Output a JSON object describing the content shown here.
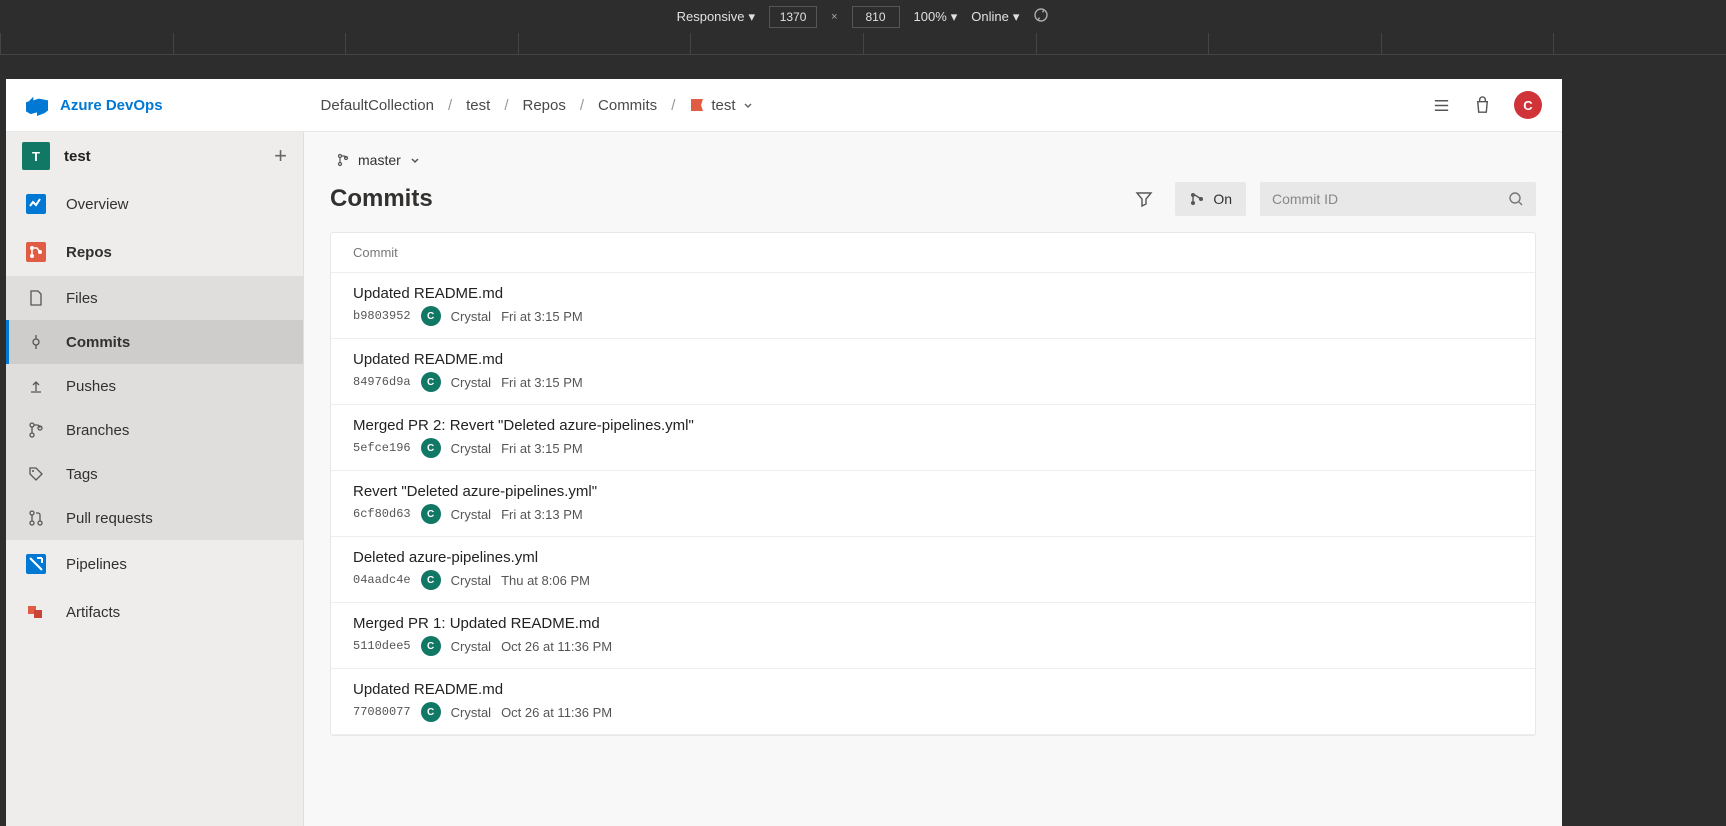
{
  "devtools": {
    "mode": "Responsive",
    "width": "1370",
    "height": "810",
    "zoom": "100%",
    "throttle": "Online"
  },
  "brand": "Azure DevOps",
  "breadcrumb": {
    "collection": "DefaultCollection",
    "project": "test",
    "section": "Repos",
    "subsection": "Commits",
    "repo": "test"
  },
  "avatar_letter": "C",
  "sidebar": {
    "project_letter": "T",
    "project_name": "test",
    "overview": "Overview",
    "repos": "Repos",
    "pipelines": "Pipelines",
    "artifacts": "Artifacts",
    "sub": {
      "files": "Files",
      "commits": "Commits",
      "pushes": "Pushes",
      "branches": "Branches",
      "tags": "Tags",
      "prs": "Pull requests"
    }
  },
  "branch": "master",
  "page_title": "Commits",
  "graph_toggle": "On",
  "search_placeholder": "Commit ID",
  "commit_header": "Commit",
  "commits": [
    {
      "title": "Updated README.md",
      "hash": "b9803952",
      "author": "Crystal",
      "date": "Fri at 3:15 PM",
      "avatar": "C"
    },
    {
      "title": "Updated README.md",
      "hash": "84976d9a",
      "author": "Crystal",
      "date": "Fri at 3:15 PM",
      "avatar": "C"
    },
    {
      "title": "Merged PR 2: Revert \"Deleted azure-pipelines.yml\"",
      "hash": "5efce196",
      "author": "Crystal",
      "date": "Fri at 3:15 PM",
      "avatar": "C"
    },
    {
      "title": "Revert \"Deleted azure-pipelines.yml\"",
      "hash": "6cf80d63",
      "author": "Crystal",
      "date": "Fri at 3:13 PM",
      "avatar": "C"
    },
    {
      "title": "Deleted azure-pipelines.yml",
      "hash": "04aadc4e",
      "author": "Crystal",
      "date": "Thu at 8:06 PM",
      "avatar": "C"
    },
    {
      "title": "Merged PR 1: Updated README.md",
      "hash": "5110dee5",
      "author": "Crystal",
      "date": "Oct 26 at 11:36 PM",
      "avatar": "C"
    },
    {
      "title": "Updated README.md",
      "hash": "77080077",
      "author": "Crystal",
      "date": "Oct 26 at 11:36 PM",
      "avatar": "C"
    }
  ]
}
